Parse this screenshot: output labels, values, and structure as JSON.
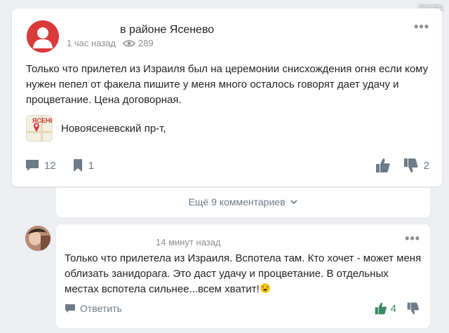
{
  "watermark": "писец",
  "post": {
    "author_area": "в районе Ясенево",
    "time": "1 час назад",
    "views": "289",
    "text": "Только что прилетел из Израиля был на церемонии снисхождения огня если кому нужен пепел от факела пишите у меня много осталось говорят дает удачу и процветание. Цена договорная.",
    "place_map_label": "ЯСЕНЕ",
    "place": "Новоясеневский пр-т,",
    "comments_count": "12",
    "bookmarks_count": "1",
    "dislikes_count": "2",
    "menu_icon": "more-dots-icon"
  },
  "more_comments": {
    "label": "Ещё 9 комментариев"
  },
  "comment": {
    "time": "14 минут назад",
    "text": "Только что прилетела из Израиля. Вспотела там. Кто хочет - может меня облизать занидорага. Это даст удачу и процветание. В отдельных местах вспотела сильнее...всем хватит!",
    "reply_label": "Ответить",
    "likes_count": "4"
  },
  "colors": {
    "avatar_red": "#d93a3a",
    "like_green": "#3b8a62",
    "icon_gray": "#6d7a88",
    "background": "#eceef1"
  }
}
